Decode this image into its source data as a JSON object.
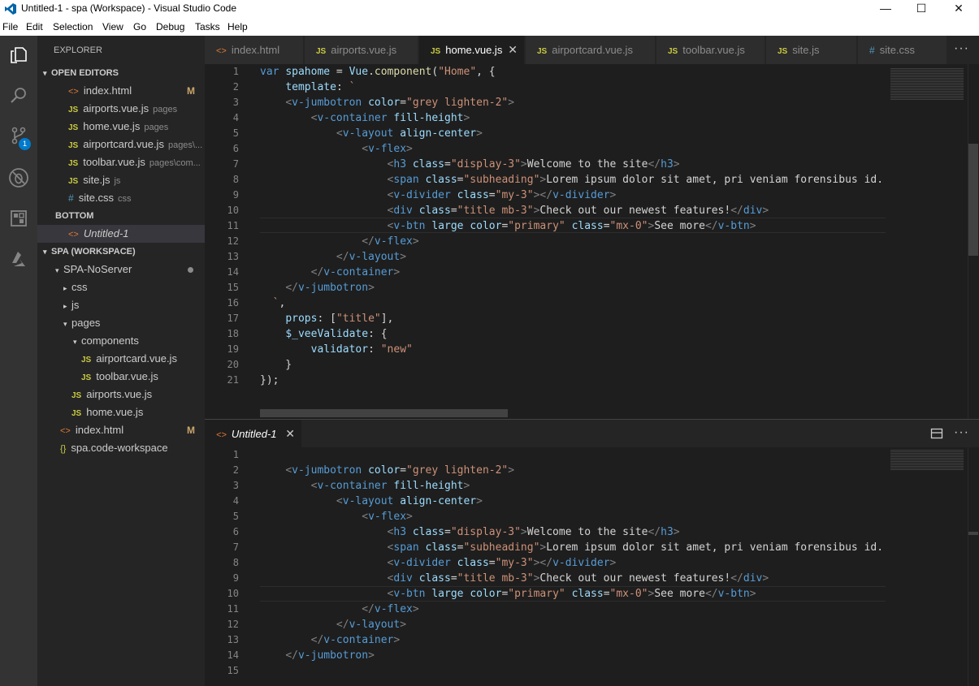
{
  "window": {
    "title": "Untitled-1 - spa (Workspace) - Visual Studio Code",
    "minimize": "—",
    "maximize": "☐",
    "close": "✕"
  },
  "menu": [
    "File",
    "Edit",
    "Selection",
    "View",
    "Go",
    "Debug",
    "Tasks",
    "Help"
  ],
  "activity": {
    "badge": "1"
  },
  "explorer": {
    "header": "EXPLORER",
    "open_editors_label": "OPEN EDITORS",
    "open_editors": [
      {
        "icon": "<>",
        "name": "index.html",
        "desc": "",
        "mod": "M"
      },
      {
        "icon": "JS",
        "name": "airports.vue.js",
        "desc": "pages",
        "mod": ""
      },
      {
        "icon": "JS",
        "name": "home.vue.js",
        "desc": "pages",
        "mod": ""
      },
      {
        "icon": "JS",
        "name": "airportcard.vue.js",
        "desc": "pages\\...",
        "mod": ""
      },
      {
        "icon": "JS",
        "name": "toolbar.vue.js",
        "desc": "pages\\com...",
        "mod": ""
      },
      {
        "icon": "JS",
        "name": "site.js",
        "desc": "js",
        "mod": ""
      },
      {
        "icon": "#",
        "name": "site.css",
        "desc": "css",
        "mod": ""
      }
    ],
    "bottom_label": "BOTTOM",
    "bottom_file": "Untitled-1",
    "workspace_label": "SPA (WORKSPACE)",
    "tree": [
      {
        "tw": "▾",
        "icon": "",
        "name": "SPA-NoServer",
        "ind": 1,
        "dot": true
      },
      {
        "tw": "▸",
        "icon": "",
        "name": "css",
        "ind": 2
      },
      {
        "tw": "▸",
        "icon": "",
        "name": "js",
        "ind": 2
      },
      {
        "tw": "▾",
        "icon": "",
        "name": "pages",
        "ind": 2
      },
      {
        "tw": "▾",
        "icon": "",
        "name": "components",
        "ind": 3
      },
      {
        "tw": "",
        "icon": "JS",
        "name": "airportcard.vue.js",
        "ind": 4
      },
      {
        "tw": "",
        "icon": "JS",
        "name": "toolbar.vue.js",
        "ind": 4
      },
      {
        "tw": "",
        "icon": "JS",
        "name": "airports.vue.js",
        "ind": 3
      },
      {
        "tw": "",
        "icon": "JS",
        "name": "home.vue.js",
        "ind": 3
      },
      {
        "tw": "",
        "icon": "<>",
        "name": "index.html",
        "ind": 2,
        "mod": "M"
      },
      {
        "tw": "",
        "icon": "{}",
        "name": "spa.code-workspace",
        "ind": 2
      }
    ]
  },
  "tabs": [
    {
      "icon": "<>",
      "name": "index.html",
      "active": false
    },
    {
      "icon": "JS",
      "name": "airports.vue.js",
      "active": false
    },
    {
      "icon": "JS",
      "name": "home.vue.js",
      "active": true,
      "close": "✕"
    },
    {
      "icon": "JS",
      "name": "airportcard.vue.js",
      "active": false
    },
    {
      "icon": "JS",
      "name": "toolbar.vue.js",
      "active": false
    },
    {
      "icon": "JS",
      "name": "site.js",
      "active": false
    },
    {
      "icon": "#",
      "name": "site.css",
      "active": false
    }
  ],
  "more_actions": "···",
  "editor1": {
    "lines": [
      [
        [
          "kw",
          "var "
        ],
        [
          "attr",
          "spahome"
        ],
        [
          "txt",
          " = "
        ],
        [
          "attr",
          "Vue"
        ],
        [
          "txt",
          "."
        ],
        [
          "fn",
          "component"
        ],
        [
          "txt",
          "("
        ],
        [
          "str",
          "\"Home\""
        ],
        [
          "txt",
          ", {"
        ]
      ],
      [
        [
          "txt",
          "    "
        ],
        [
          "prop",
          "template"
        ],
        [
          "txt",
          ": "
        ],
        [
          "str",
          "`"
        ]
      ],
      [
        [
          "txt",
          "    "
        ],
        [
          "gr",
          "<"
        ],
        [
          "tag",
          "v-jumbotron"
        ],
        [
          "txt",
          " "
        ],
        [
          "attr",
          "color"
        ],
        [
          "txt",
          "="
        ],
        [
          "str",
          "\"grey lighten-2\""
        ],
        [
          "gr",
          ">"
        ]
      ],
      [
        [
          "txt",
          "        "
        ],
        [
          "gr",
          "<"
        ],
        [
          "tag",
          "v-container"
        ],
        [
          "txt",
          " "
        ],
        [
          "attr",
          "fill-height"
        ],
        [
          "gr",
          ">"
        ]
      ],
      [
        [
          "txt",
          "            "
        ],
        [
          "gr",
          "<"
        ],
        [
          "tag",
          "v-layout"
        ],
        [
          "txt",
          " "
        ],
        [
          "attr",
          "align-center"
        ],
        [
          "gr",
          ">"
        ]
      ],
      [
        [
          "txt",
          "                "
        ],
        [
          "gr",
          "<"
        ],
        [
          "tag",
          "v-flex"
        ],
        [
          "gr",
          ">"
        ]
      ],
      [
        [
          "txt",
          "                    "
        ],
        [
          "gr",
          "<"
        ],
        [
          "tag",
          "h3"
        ],
        [
          "txt",
          " "
        ],
        [
          "attr",
          "class"
        ],
        [
          "txt",
          "="
        ],
        [
          "str",
          "\"display-3\""
        ],
        [
          "gr",
          ">"
        ],
        [
          "txt",
          "Welcome to the site"
        ],
        [
          "gr",
          "</"
        ],
        [
          "tag",
          "h3"
        ],
        [
          "gr",
          ">"
        ]
      ],
      [
        [
          "txt",
          "                    "
        ],
        [
          "gr",
          "<"
        ],
        [
          "tag",
          "span"
        ],
        [
          "txt",
          " "
        ],
        [
          "attr",
          "class"
        ],
        [
          "txt",
          "="
        ],
        [
          "str",
          "\"subheading\""
        ],
        [
          "gr",
          ">"
        ],
        [
          "txt",
          "Lorem ipsum dolor sit amet, pri veniam forensibus id. V"
        ]
      ],
      [
        [
          "txt",
          "                    "
        ],
        [
          "gr",
          "<"
        ],
        [
          "tag",
          "v-divider"
        ],
        [
          "txt",
          " "
        ],
        [
          "attr",
          "class"
        ],
        [
          "txt",
          "="
        ],
        [
          "str",
          "\"my-3\""
        ],
        [
          "gr",
          "></"
        ],
        [
          "tag",
          "v-divider"
        ],
        [
          "gr",
          ">"
        ]
      ],
      [
        [
          "txt",
          "                    "
        ],
        [
          "gr",
          "<"
        ],
        [
          "tag",
          "div"
        ],
        [
          "txt",
          " "
        ],
        [
          "attr",
          "class"
        ],
        [
          "txt",
          "="
        ],
        [
          "str",
          "\"title mb-3\""
        ],
        [
          "gr",
          ">"
        ],
        [
          "txt",
          "Check out our newest features!"
        ],
        [
          "gr",
          "</"
        ],
        [
          "tag",
          "div"
        ],
        [
          "gr",
          ">"
        ]
      ],
      [
        [
          "txt",
          "                    "
        ],
        [
          "gr",
          "<"
        ],
        [
          "tag",
          "v-btn"
        ],
        [
          "txt",
          " "
        ],
        [
          "attr",
          "large"
        ],
        [
          "txt",
          " "
        ],
        [
          "attr",
          "color"
        ],
        [
          "txt",
          "="
        ],
        [
          "str",
          "\"primary\""
        ],
        [
          "txt",
          " "
        ],
        [
          "attr",
          "class"
        ],
        [
          "txt",
          "="
        ],
        [
          "str",
          "\"mx-0\""
        ],
        [
          "gr",
          ">"
        ],
        [
          "txt",
          "See more"
        ],
        [
          "gr",
          "</"
        ],
        [
          "tag",
          "v-btn"
        ],
        [
          "gr",
          ">"
        ]
      ],
      [
        [
          "txt",
          "                "
        ],
        [
          "gr",
          "</"
        ],
        [
          "tag",
          "v-flex"
        ],
        [
          "gr",
          ">"
        ]
      ],
      [
        [
          "txt",
          "            "
        ],
        [
          "gr",
          "</"
        ],
        [
          "tag",
          "v-layout"
        ],
        [
          "gr",
          ">"
        ]
      ],
      [
        [
          "txt",
          "        "
        ],
        [
          "gr",
          "</"
        ],
        [
          "tag",
          "v-container"
        ],
        [
          "gr",
          ">"
        ]
      ],
      [
        [
          "txt",
          "    "
        ],
        [
          "gr",
          "</"
        ],
        [
          "tag",
          "v-jumbotron"
        ],
        [
          "gr",
          ">"
        ]
      ],
      [
        [
          "txt",
          "  "
        ],
        [
          "str",
          "`"
        ],
        [
          "txt",
          ","
        ]
      ],
      [
        [
          "txt",
          "    "
        ],
        [
          "prop",
          "props"
        ],
        [
          "txt",
          ": ["
        ],
        [
          "str",
          "\"title\""
        ],
        [
          "txt",
          "],"
        ]
      ],
      [
        [
          "txt",
          "    "
        ],
        [
          "prop",
          "$_veeValidate"
        ],
        [
          "txt",
          ": {"
        ]
      ],
      [
        [
          "txt",
          "        "
        ],
        [
          "prop",
          "validator"
        ],
        [
          "txt",
          ": "
        ],
        [
          "str",
          "\"new\""
        ]
      ],
      [
        [
          "txt",
          "    }"
        ]
      ],
      [
        [
          "txt",
          "});"
        ]
      ]
    ]
  },
  "editor2": {
    "tab": "Untitled-1",
    "close": "✕",
    "lines": [
      [
        [
          "txt",
          ""
        ]
      ],
      [
        [
          "txt",
          "    "
        ],
        [
          "gr",
          "<"
        ],
        [
          "tag",
          "v-jumbotron"
        ],
        [
          "txt",
          " "
        ],
        [
          "attr",
          "color"
        ],
        [
          "txt",
          "="
        ],
        [
          "str",
          "\"grey lighten-2\""
        ],
        [
          "gr",
          ">"
        ]
      ],
      [
        [
          "txt",
          "        "
        ],
        [
          "gr",
          "<"
        ],
        [
          "tag",
          "v-container"
        ],
        [
          "txt",
          " "
        ],
        [
          "attr",
          "fill-height"
        ],
        [
          "gr",
          ">"
        ]
      ],
      [
        [
          "txt",
          "            "
        ],
        [
          "gr",
          "<"
        ],
        [
          "tag",
          "v-layout"
        ],
        [
          "txt",
          " "
        ],
        [
          "attr",
          "align-center"
        ],
        [
          "gr",
          ">"
        ]
      ],
      [
        [
          "txt",
          "                "
        ],
        [
          "gr",
          "<"
        ],
        [
          "tag",
          "v-flex"
        ],
        [
          "gr",
          ">"
        ]
      ],
      [
        [
          "txt",
          "                    "
        ],
        [
          "gr",
          "<"
        ],
        [
          "tag",
          "h3"
        ],
        [
          "txt",
          " "
        ],
        [
          "attr",
          "class"
        ],
        [
          "txt",
          "="
        ],
        [
          "str",
          "\"display-3\""
        ],
        [
          "gr",
          ">"
        ],
        [
          "txt",
          "Welcome to the site"
        ],
        [
          "gr",
          "</"
        ],
        [
          "tag",
          "h3"
        ],
        [
          "gr",
          ">"
        ]
      ],
      [
        [
          "txt",
          "                    "
        ],
        [
          "gr",
          "<"
        ],
        [
          "tag",
          "span"
        ],
        [
          "txt",
          " "
        ],
        [
          "attr",
          "class"
        ],
        [
          "txt",
          "="
        ],
        [
          "str",
          "\"subheading\""
        ],
        [
          "gr",
          ">"
        ],
        [
          "txt",
          "Lorem ipsum dolor sit amet, pri veniam forensibus id. V"
        ]
      ],
      [
        [
          "txt",
          "                    "
        ],
        [
          "gr",
          "<"
        ],
        [
          "tag",
          "v-divider"
        ],
        [
          "txt",
          " "
        ],
        [
          "attr",
          "class"
        ],
        [
          "txt",
          "="
        ],
        [
          "str",
          "\"my-3\""
        ],
        [
          "gr",
          "></"
        ],
        [
          "tag",
          "v-divider"
        ],
        [
          "gr",
          ">"
        ]
      ],
      [
        [
          "txt",
          "                    "
        ],
        [
          "gr",
          "<"
        ],
        [
          "tag",
          "div"
        ],
        [
          "txt",
          " "
        ],
        [
          "attr",
          "class"
        ],
        [
          "txt",
          "="
        ],
        [
          "str",
          "\"title mb-3\""
        ],
        [
          "gr",
          ">"
        ],
        [
          "txt",
          "Check out our newest features!"
        ],
        [
          "gr",
          "</"
        ],
        [
          "tag",
          "div"
        ],
        [
          "gr",
          ">"
        ]
      ],
      [
        [
          "txt",
          "                    "
        ],
        [
          "gr",
          "<"
        ],
        [
          "tag",
          "v-btn"
        ],
        [
          "txt",
          " "
        ],
        [
          "attr",
          "large"
        ],
        [
          "txt",
          " "
        ],
        [
          "attr",
          "color"
        ],
        [
          "txt",
          "="
        ],
        [
          "str",
          "\"primary\""
        ],
        [
          "txt",
          " "
        ],
        [
          "attr",
          "class"
        ],
        [
          "txt",
          "="
        ],
        [
          "str",
          "\"mx-0\""
        ],
        [
          "gr",
          ">"
        ],
        [
          "txt",
          "See more"
        ],
        [
          "gr",
          "</"
        ],
        [
          "tag",
          "v-btn"
        ],
        [
          "gr",
          ">"
        ]
      ],
      [
        [
          "txt",
          "                "
        ],
        [
          "gr",
          "</"
        ],
        [
          "tag",
          "v-flex"
        ],
        [
          "gr",
          ">"
        ]
      ],
      [
        [
          "txt",
          "            "
        ],
        [
          "gr",
          "</"
        ],
        [
          "tag",
          "v-layout"
        ],
        [
          "gr",
          ">"
        ]
      ],
      [
        [
          "txt",
          "        "
        ],
        [
          "gr",
          "</"
        ],
        [
          "tag",
          "v-container"
        ],
        [
          "gr",
          ">"
        ]
      ],
      [
        [
          "txt",
          "    "
        ],
        [
          "gr",
          "</"
        ],
        [
          "tag",
          "v-jumbotron"
        ],
        [
          "gr",
          ">"
        ]
      ],
      [
        [
          "txt",
          ""
        ]
      ]
    ]
  }
}
